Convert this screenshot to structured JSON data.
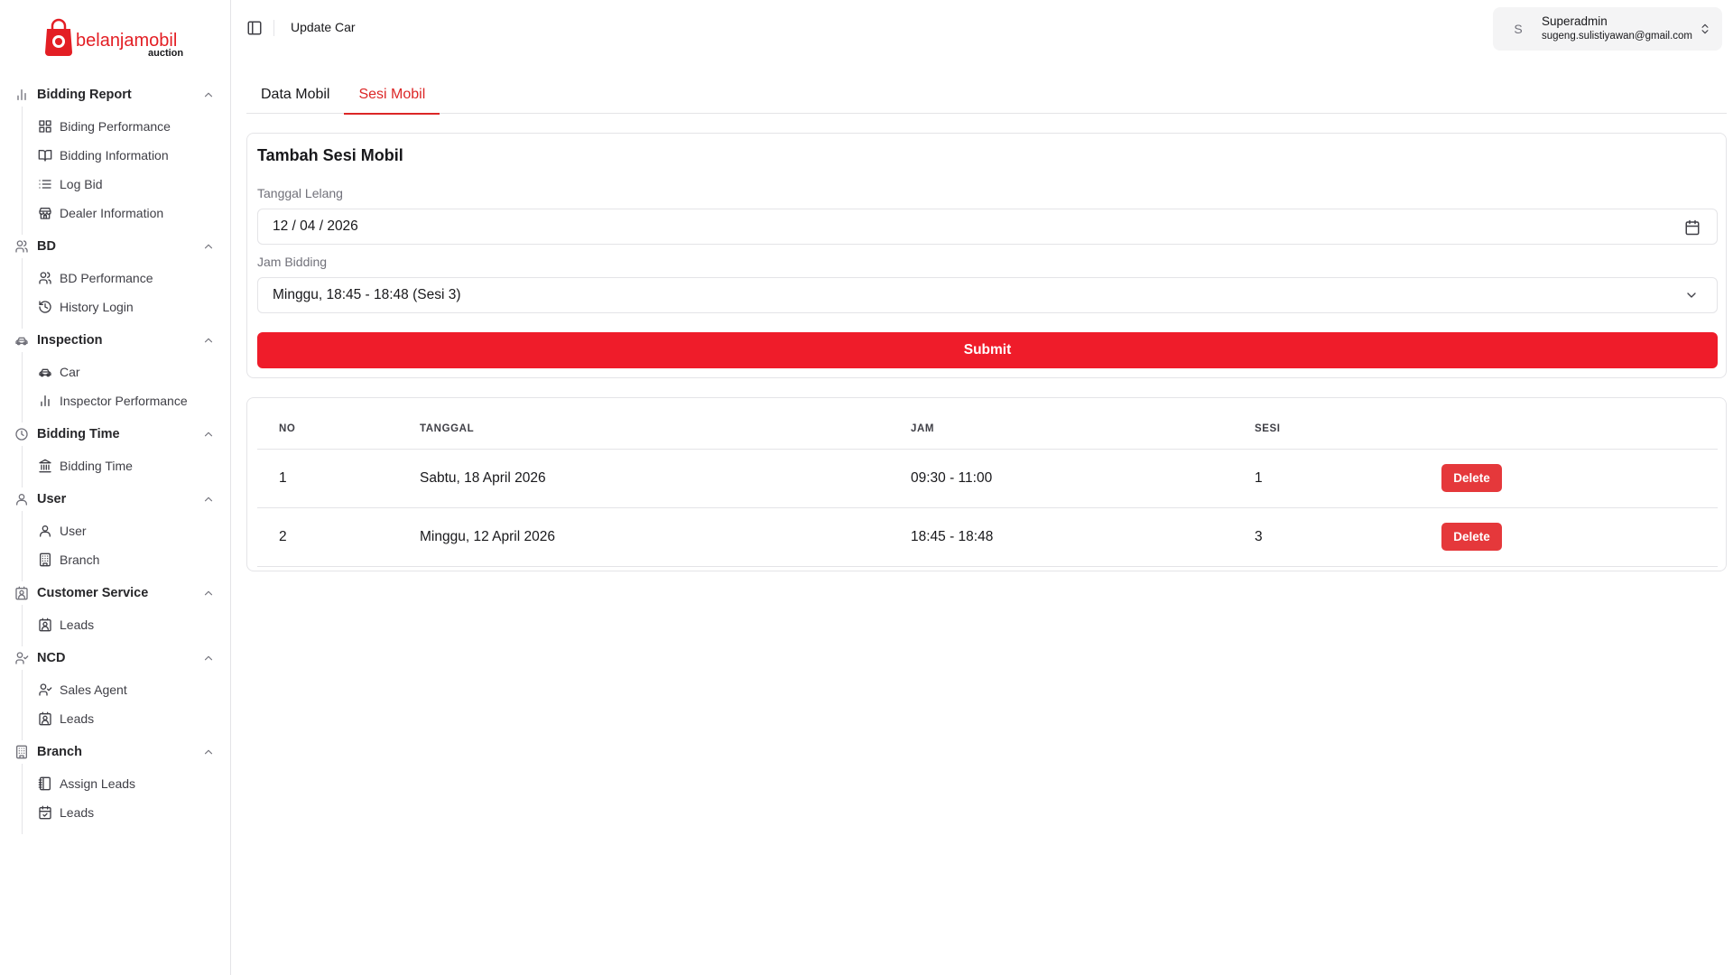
{
  "brand": {
    "name": "belanjamobil",
    "sub": "auction",
    "color": "#e31e24"
  },
  "accent_color": "#ef1c2a",
  "header": {
    "breadcrumb": "Update Car",
    "user_initial": "S",
    "user_name": "Superadmin",
    "user_email": "sugeng.sulistiyawan@gmail.com"
  },
  "sidebar": {
    "groups": [
      {
        "label": "Bidding Report",
        "icon": "bar-chart-icon",
        "items": [
          {
            "label": "Biding Performance",
            "icon": "layout-grid-icon"
          },
          {
            "label": "Bidding Information",
            "icon": "book-open-icon"
          },
          {
            "label": "Log Bid",
            "icon": "list-icon"
          },
          {
            "label": "Dealer Information",
            "icon": "store-icon"
          }
        ]
      },
      {
        "label": "BD",
        "icon": "users-icon",
        "items": [
          {
            "label": "BD Performance",
            "icon": "users-icon"
          },
          {
            "label": "History Login",
            "icon": "history-icon"
          }
        ]
      },
      {
        "label": "Inspection",
        "icon": "car-icon",
        "items": [
          {
            "label": "Car",
            "icon": "car-icon"
          },
          {
            "label": "Inspector Performance",
            "icon": "bar-chart-icon"
          }
        ]
      },
      {
        "label": "Bidding Time",
        "icon": "clock-icon",
        "items": [
          {
            "label": "Bidding Time",
            "icon": "landmark-icon"
          }
        ]
      },
      {
        "label": "User",
        "icon": "user-icon",
        "items": [
          {
            "label": "User",
            "icon": "user-icon"
          },
          {
            "label": "Branch",
            "icon": "building-icon"
          }
        ]
      },
      {
        "label": "Customer Service",
        "icon": "contact-icon",
        "items": [
          {
            "label": "Leads",
            "icon": "contact-icon"
          }
        ]
      },
      {
        "label": "NCD",
        "icon": "user-check-icon",
        "items": [
          {
            "label": "Sales Agent",
            "icon": "user-check-icon"
          },
          {
            "label": "Leads",
            "icon": "contact-icon"
          }
        ]
      },
      {
        "label": "Branch",
        "icon": "building-icon",
        "items": [
          {
            "label": "Assign Leads",
            "icon": "notebook-icon"
          },
          {
            "label": "Leads",
            "icon": "calendar-check-icon"
          }
        ]
      }
    ]
  },
  "tabs": [
    {
      "label": "Data Mobil",
      "active": false
    },
    {
      "label": "Sesi Mobil",
      "active": true
    }
  ],
  "form": {
    "title": "Tambah Sesi Mobil",
    "date_label": "Tanggal Lelang",
    "date_value": "12 / 04 / 2026",
    "time_label": "Jam Bidding",
    "time_value": "Minggu, 18:45 - 18:48 (Sesi 3)",
    "submit_label": "Submit"
  },
  "table": {
    "columns": [
      "NO",
      "TANGGAL",
      "JAM",
      "SESI",
      ""
    ],
    "rows": [
      {
        "no": "1",
        "tanggal": "Sabtu, 18 April 2026",
        "jam": "09:30 - 11:00",
        "sesi": "1",
        "action": "Delete"
      },
      {
        "no": "2",
        "tanggal": "Minggu, 12 April 2026",
        "jam": "18:45 - 18:48",
        "sesi": "3",
        "action": "Delete"
      }
    ]
  }
}
